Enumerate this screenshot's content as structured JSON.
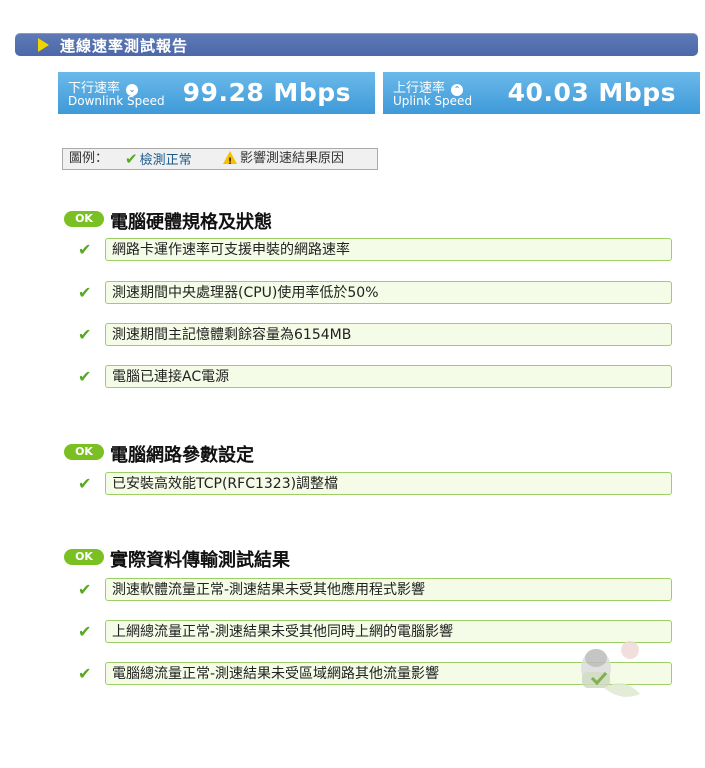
{
  "header": {
    "title": "連線速率測試報告"
  },
  "speeds": {
    "downlink": {
      "label_zh": "下行速率",
      "label_en": "Downlink Speed",
      "value": "99.28 Mbps"
    },
    "uplink": {
      "label_zh": "上行速率",
      "label_en": "Uplink Speed",
      "value": "40.03 Mbps"
    }
  },
  "legend": {
    "title": "圖例：",
    "ok_label": "檢測正常",
    "warn_label": "影響測速結果原因"
  },
  "sections": [
    {
      "badge": "OK",
      "title": "電腦硬體規格及狀態",
      "items": [
        "網路卡運作速率可支援申裝的網路速率",
        "測速期間中央處理器(CPU)使用率低於50%",
        "測速期間主記憶體剩餘容量為6154MB",
        "電腦已連接AC電源"
      ]
    },
    {
      "badge": "OK",
      "title": "電腦網路參數設定",
      "items": [
        "已安裝高效能TCP(RFC1323)調整檔"
      ]
    },
    {
      "badge": "OK",
      "title": "實際資料傳輸測試結果",
      "items": [
        "測速軟體流量正常-測速結果未受其他應用程式影響",
        "上網總流量正常-測速結果未受其他同時上網的電腦影響",
        "電腦總流量正常-測速結果未受區域網路其他流量影響"
      ]
    }
  ],
  "icons": {
    "check": "✔",
    "down_arrow": "⌄",
    "up_arrow": "⌃"
  },
  "colors": {
    "title_bar": "#4c68a8",
    "speed_box": "#3e9ad8",
    "ok_green": "#7bc023",
    "item_border": "#9ccf64"
  }
}
